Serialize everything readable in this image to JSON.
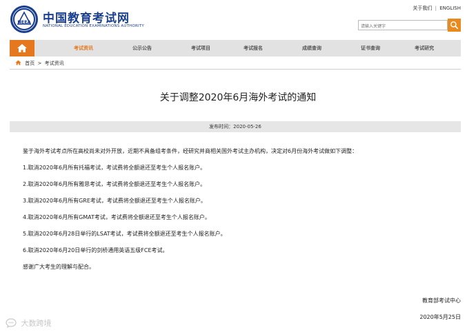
{
  "header": {
    "site_name_cn": "中国教育考试网",
    "site_name_en": "NATIONAL EDUCATION EXAMINATIONS AUTHORITY",
    "seal_text": "NEEA",
    "top_links": {
      "about": "关于我们",
      "separator": "|",
      "english": "ENGLISH"
    },
    "search": {
      "placeholder": "请输入关键字"
    }
  },
  "nav": {
    "items": [
      {
        "label": "考试资讯",
        "active": true
      },
      {
        "label": "公示公告"
      },
      {
        "label": "考试项目"
      },
      {
        "label": "考试报名"
      },
      {
        "label": "成绩查询"
      },
      {
        "label": "证书查询"
      },
      {
        "label": "考试研究"
      }
    ]
  },
  "breadcrumb": {
    "home": "首页",
    "separator": ">",
    "current": "考试资讯"
  },
  "article": {
    "title": "关于调整2020年6月海外考试的通知",
    "publish_label": "发布时间：",
    "publish_date": "2020-05-26",
    "paragraphs": [
      "鉴于海外考试考点所在高校尚未对外开放，近期不具备组考条件，经研究并商相关国外考试主办机构，决定对6月份海外考试做如下调整：",
      "1.取消2020年6月所有托福考试，考试费将全额退还至考生个人报名账户。",
      "2.取消2020年6月所有雅思考试，考试费将全额退还至考生个人报名账户。",
      "3.取消2020年6月所有GRE考试，考试费将全额退还至考生个人报名账户。",
      "4.取消2020年6月所有GMAT考试，考试费将全额退还至考生个人报名账户。",
      "5.取消2020年6月28日举行的LSAT考试，考试费将全额退还至考生个人报名账户。",
      "6.取消2020年6月20日举行的剑桥通用英语五级FCE考试。",
      "感谢广大考生的理解与配合。"
    ],
    "signature_org": "教育部考试中心",
    "signature_date": "2020年5月25日"
  },
  "watermark": {
    "text": "大数跨境"
  },
  "colors": {
    "brand_blue": "#1a3f8f",
    "accent_orange": "#e5781e",
    "nav_bg": "#e2e2e2"
  }
}
